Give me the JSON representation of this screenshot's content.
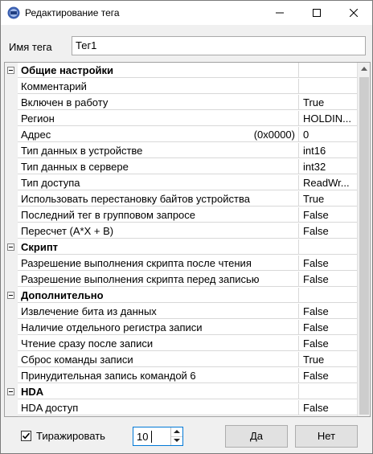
{
  "window": {
    "title": "Редактирование тега"
  },
  "name": {
    "label": "Имя тега",
    "value": "Тег1"
  },
  "properties": [
    {
      "type": "category",
      "name": "Общие настройки"
    },
    {
      "type": "item",
      "name": "Комментарий",
      "value": ""
    },
    {
      "type": "item",
      "name": "Включен в работу",
      "value": "True"
    },
    {
      "type": "item",
      "name": "Регион",
      "value": "HOLDIN..."
    },
    {
      "type": "item",
      "name": "Адрес",
      "suffix": "(0x0000)",
      "value": "0"
    },
    {
      "type": "item",
      "name": "Тип данных в устройстве",
      "value": "int16"
    },
    {
      "type": "item",
      "name": "Тип данных в сервере",
      "value": "int32"
    },
    {
      "type": "item",
      "name": "Тип доступа",
      "value": "ReadWr..."
    },
    {
      "type": "item",
      "name": "Использовать перестановку байтов устройства",
      "value": "True"
    },
    {
      "type": "item",
      "name": "Последний тег в групповом запросе",
      "value": "False"
    },
    {
      "type": "item",
      "name": "Пересчет (A*X + B)",
      "value": "False"
    },
    {
      "type": "category",
      "name": "Скрипт"
    },
    {
      "type": "item",
      "name": "Разрешение выполнения скрипта после чтения",
      "value": "False"
    },
    {
      "type": "item",
      "name": "Разрешение выполнения скрипта перед записью",
      "value": "False"
    },
    {
      "type": "category",
      "name": "Дополнительно"
    },
    {
      "type": "item",
      "name": "Извлечение бита из данных",
      "value": "False"
    },
    {
      "type": "item",
      "name": "Наличие отдельного регистра записи",
      "value": "False"
    },
    {
      "type": "item",
      "name": "Чтение сразу после записи",
      "value": "False"
    },
    {
      "type": "item",
      "name": "Сброс команды записи",
      "value": "True"
    },
    {
      "type": "item",
      "name": "Принудительная запись командой 6",
      "value": "False"
    },
    {
      "type": "category",
      "name": "HDA"
    },
    {
      "type": "item",
      "name": "HDA доступ",
      "value": "False"
    }
  ],
  "footer": {
    "replicate_label": "Тиражировать",
    "replicate_checked": true,
    "count_value": "10",
    "ok_label": "Да",
    "cancel_label": "Нет"
  }
}
